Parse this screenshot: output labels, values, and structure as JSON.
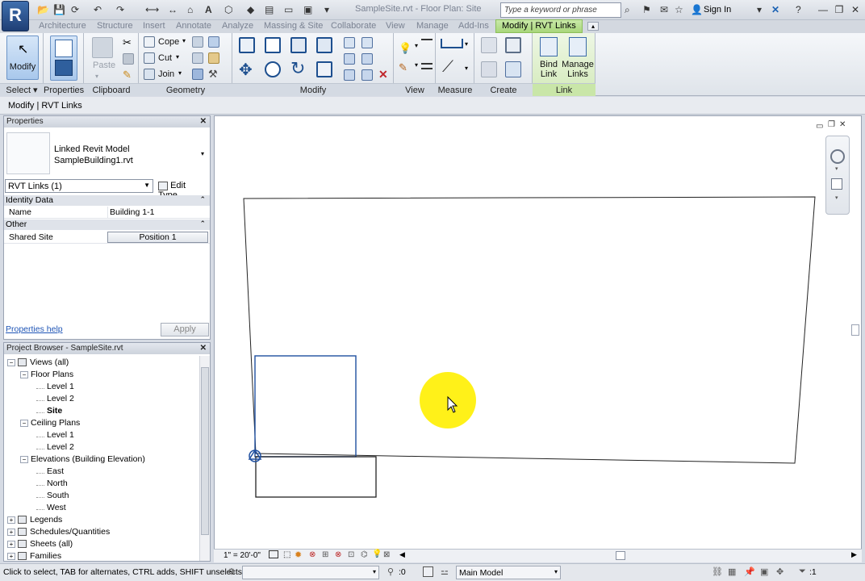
{
  "title_bar": {
    "document_title": "SampleSite.rvt - Floor Plan: Site",
    "search_placeholder": "Type a keyword or phrase",
    "sign_in": "Sign In",
    "app_initial": "R"
  },
  "ribbon_tabs": [
    "Architecture",
    "Structure",
    "Insert",
    "Annotate",
    "Analyze",
    "Massing & Site",
    "Collaborate",
    "View",
    "Manage",
    "Add-Ins",
    "Modify | RVT Links"
  ],
  "ribbon": {
    "select": {
      "modify": "Modify",
      "panel": "Select"
    },
    "properties": {
      "panel": "Properties"
    },
    "clipboard": {
      "paste": "Paste",
      "panel": "Clipboard"
    },
    "geometry": {
      "cope": "Cope",
      "cut": "Cut",
      "join": "Join",
      "panel": "Geometry"
    },
    "modify": {
      "panel": "Modify"
    },
    "view": {
      "panel": "View"
    },
    "measure": {
      "panel": "Measure"
    },
    "create": {
      "panel": "Create"
    },
    "link": {
      "bind_link": "Bind Link",
      "manage_links": "Manage Links",
      "panel": "Link"
    }
  },
  "options_bar": {
    "context": "Modify | RVT Links"
  },
  "properties_palette": {
    "title": "Properties",
    "type_line1": "Linked Revit Model",
    "type_line2": "SampleBuilding1.rvt",
    "selector": "RVT Links (1)",
    "edit_type": "Edit Type",
    "groups": [
      {
        "name": "Identity Data",
        "rows": [
          {
            "label": "Name",
            "value": "Building 1-1"
          }
        ]
      },
      {
        "name": "Other",
        "rows": [
          {
            "label": "Shared Site",
            "value": "Position 1"
          }
        ]
      }
    ],
    "help": "Properties help",
    "apply": "Apply"
  },
  "project_browser": {
    "title": "Project Browser - SampleSite.rvt",
    "items": [
      {
        "label": "Views (all)",
        "level": 0,
        "bold": false
      },
      {
        "label": "Floor Plans",
        "level": 1,
        "bold": false
      },
      {
        "label": "Level 1",
        "level": 2,
        "bold": false
      },
      {
        "label": "Level 2",
        "level": 2,
        "bold": false
      },
      {
        "label": "Site",
        "level": 2,
        "bold": true
      },
      {
        "label": "Ceiling Plans",
        "level": 1,
        "bold": false
      },
      {
        "label": "Level 1",
        "level": 2,
        "bold": false
      },
      {
        "label": "Level 2",
        "level": 2,
        "bold": false
      },
      {
        "label": "Elevations (Building Elevation)",
        "level": 1,
        "bold": false
      },
      {
        "label": "East",
        "level": 2,
        "bold": false
      },
      {
        "label": "North",
        "level": 2,
        "bold": false
      },
      {
        "label": "South",
        "level": 2,
        "bold": false
      },
      {
        "label": "West",
        "level": 2,
        "bold": false
      },
      {
        "label": "Legends",
        "level": 0,
        "bold": false
      },
      {
        "label": "Schedules/Quantities",
        "level": 0,
        "bold": false
      },
      {
        "label": "Sheets (all)",
        "level": 0,
        "bold": false
      },
      {
        "label": "Families",
        "level": 0,
        "bold": false
      }
    ]
  },
  "view_control_bar": {
    "scale": "1\" = 20'-0\""
  },
  "status_bar": {
    "message": "Click to select, TAB for alternates, CTRL adds, SHIFT unselects",
    "worksets_count": ":0",
    "model": "Main Model",
    "filter_count": ":1"
  },
  "colors": {
    "accent_green": "#a8d67a",
    "selection_blue": "#1f4fa0",
    "cursor_highlight": "#ffef00"
  }
}
